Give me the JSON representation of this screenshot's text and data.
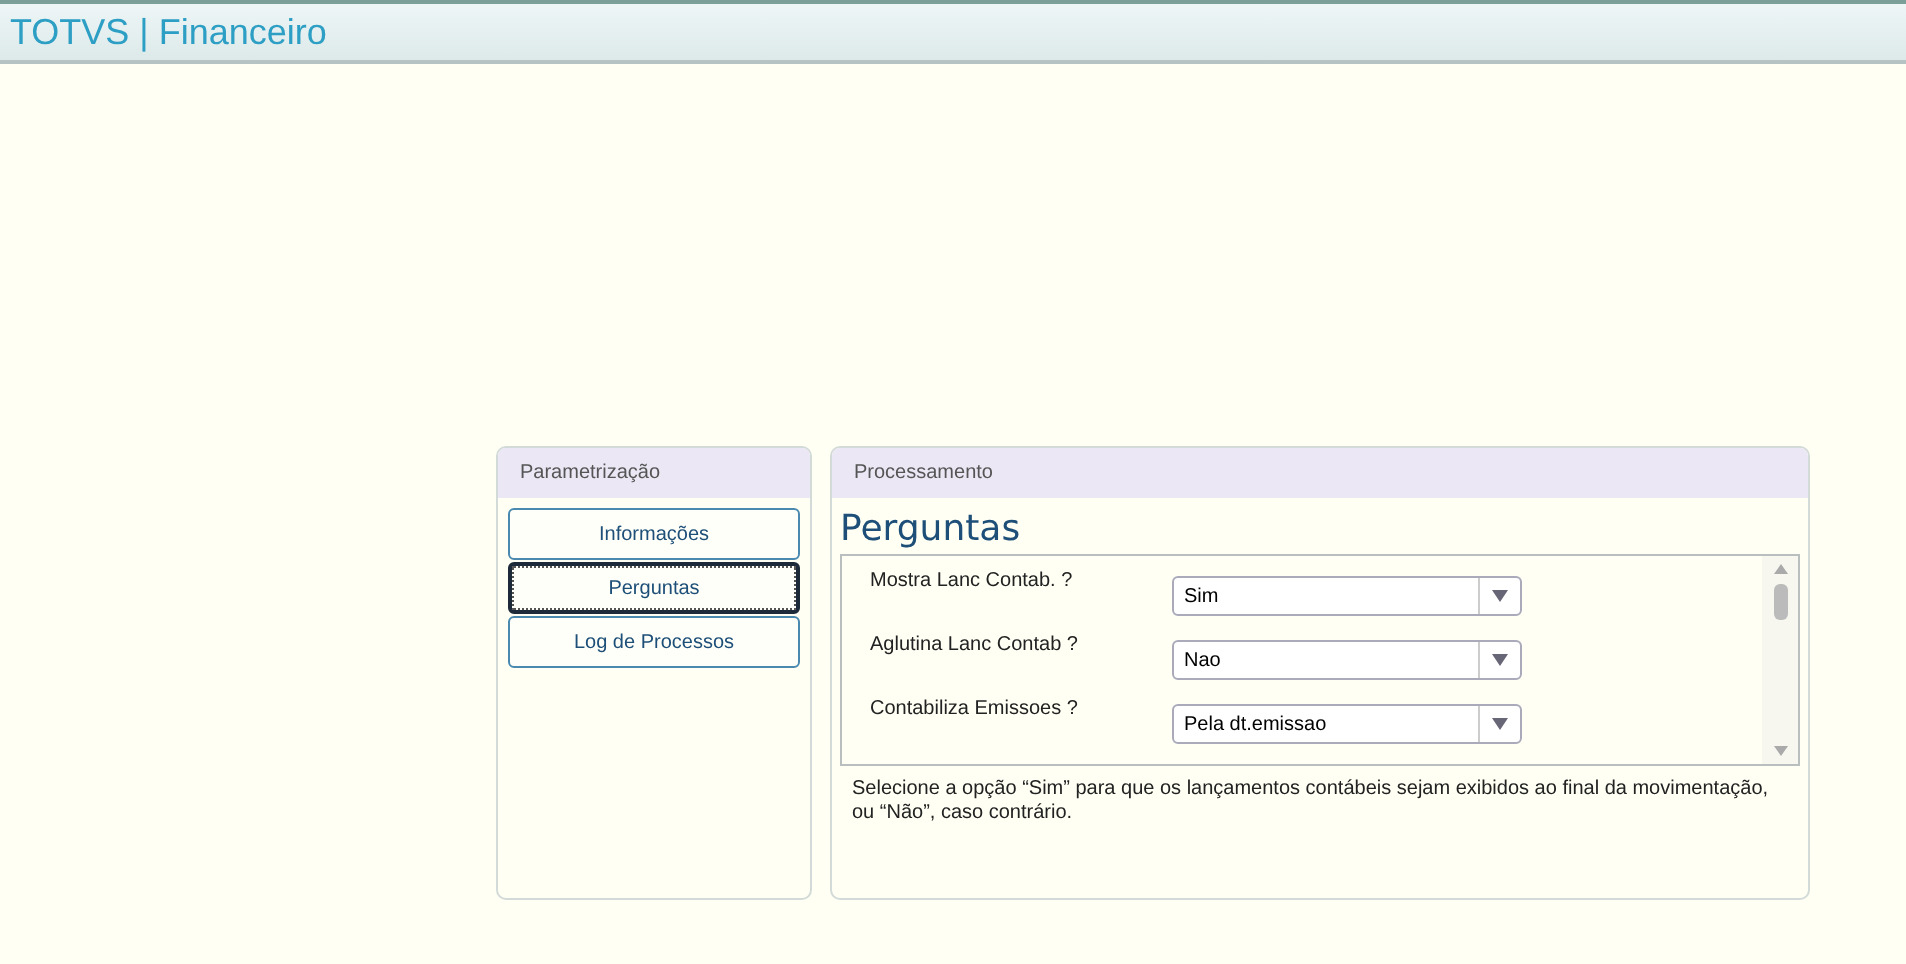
{
  "header": {
    "title": "TOTVS | Financeiro"
  },
  "left_panel": {
    "title": "Parametrização",
    "items": [
      {
        "label": "Informações",
        "selected": false
      },
      {
        "label": "Perguntas",
        "selected": true
      },
      {
        "label": "Log de Processos",
        "selected": false
      }
    ]
  },
  "right_panel": {
    "title": "Processamento",
    "heading": "Perguntas",
    "questions": [
      {
        "label": "Mostra Lanc Contab. ?",
        "value": "Sim"
      },
      {
        "label": "Aglutina Lanc Contab ?",
        "value": "Nao"
      },
      {
        "label": "Contabiliza Emissoes ?",
        "value": "Pela dt.emissao"
      }
    ],
    "help": "Selecione a opção “Sim” para que os lançamentos contábeis sejam exibidos ao final da movimentação, ou “Não”, caso contrário."
  }
}
